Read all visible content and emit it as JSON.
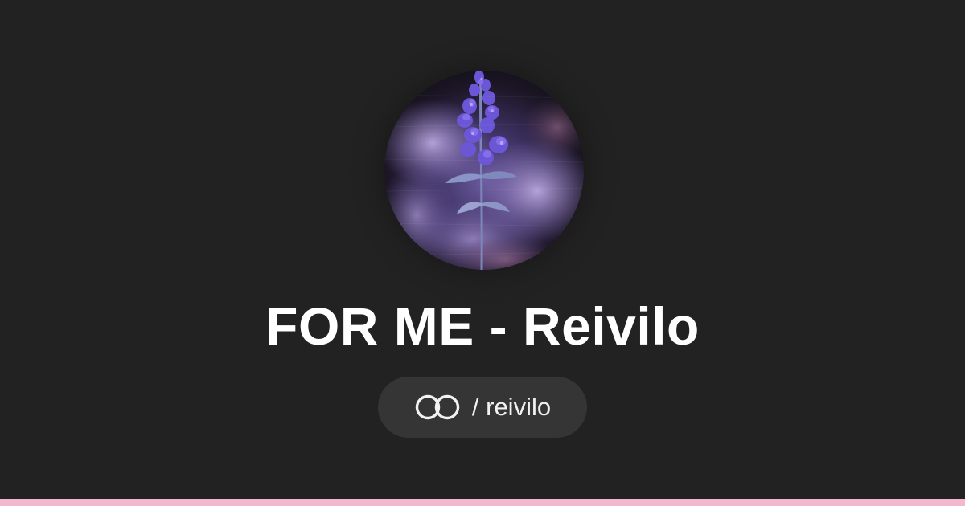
{
  "page": {
    "title": "FOR ME - Reivilo",
    "handle_separator": "/",
    "handle": "reivilo",
    "display_handle": "/ reivilo"
  },
  "avatar": {
    "subject": "lavender-flower-painting"
  },
  "icons": {
    "logo": "linked-rings-icon"
  },
  "colors": {
    "background": "#222222",
    "pill": "#353535",
    "text": "#ffffff",
    "accent_bar": "#f3b8ce"
  }
}
